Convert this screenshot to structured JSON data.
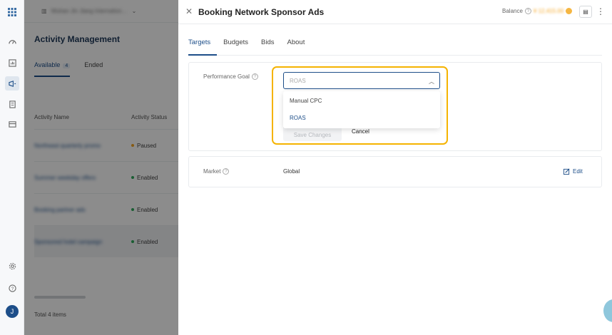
{
  "rail": {
    "icons": [
      "apps-grid-icon",
      "dashboard-icon",
      "report-icon",
      "megaphone-icon",
      "document-icon",
      "billing-icon"
    ],
    "avatar_letter": "J"
  },
  "background": {
    "account_name": "Wuhan Jin Jiang Internation…",
    "page_title": "Activity Management",
    "tabs": [
      {
        "label": "Available",
        "count": "4"
      },
      {
        "label": "Ended"
      }
    ],
    "columns": [
      "Activity Name",
      "Activity Status"
    ],
    "rows": [
      {
        "name": "Northeast quarterly promo",
        "status": "Paused",
        "status_color": "#f5a623"
      },
      {
        "name": "Summer weekday offers",
        "status": "Enabled",
        "status_color": "#2eaa5c"
      },
      {
        "name": "Booking partner ads",
        "status": "Enabled",
        "status_color": "#2eaa5c"
      },
      {
        "name": "Sponsored hotel campaign",
        "status": "Enabled",
        "status_color": "#2eaa5c"
      }
    ],
    "total": "Total 4 items"
  },
  "drawer": {
    "title": "Booking Network Sponsor Ads",
    "balance_label": "Balance",
    "balance_value": "¥ 12,415.00",
    "tabs": [
      "Targets",
      "Budgets",
      "Bids",
      "About"
    ],
    "performance_goal": {
      "label": "Performance Goal",
      "selected": "ROAS",
      "options": [
        "Manual CPC",
        "ROAS"
      ],
      "save_label": "Save Changes",
      "cancel_label": "Cancel"
    },
    "market": {
      "label": "Market",
      "value": "Global",
      "edit_label": "Edit"
    }
  },
  "colors": {
    "accent": "#1d4e89",
    "highlight": "#f5b300"
  }
}
